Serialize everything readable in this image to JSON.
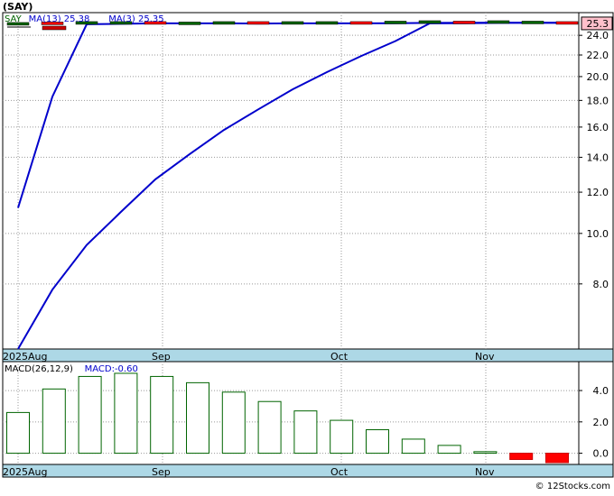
{
  "title": "(SAY)",
  "watermark": "© 12Stocks.com",
  "chart_data": [
    {
      "type": "line",
      "panel": "price",
      "legend": [
        {
          "label": "SAY",
          "color": "#006400"
        },
        {
          "label": "MA(13)",
          "value": "25.38",
          "color": "#0000cc"
        },
        {
          "label": "MA(3)",
          "value": "25.35",
          "color": "#0000cc"
        }
      ],
      "last_price_label": "25.3",
      "y_scale": "log",
      "ylim": [
        6.0,
        24.5
      ],
      "yticks": [
        "8.0",
        "10.0",
        "12.0",
        "14.0",
        "16.0",
        "18.0",
        "20.0",
        "22.0",
        "24.0"
      ],
      "x_months": [
        "2025Aug",
        "Sep",
        "Oct",
        "Nov"
      ],
      "price": [
        25.2,
        25.25,
        25.3,
        25.3,
        25.3,
        25.25,
        25.3,
        25.3,
        25.3,
        25.3,
        25.3,
        25.35,
        25.4,
        25.35,
        25.4,
        25.35,
        25.3
      ],
      "series": [
        {
          "name": "MA(3)",
          "values": [
            11.2,
            18.3,
            25.2,
            25.25,
            25.3,
            25.3,
            25.3,
            25.28,
            25.3,
            25.3,
            25.3,
            25.32,
            25.35,
            25.37,
            25.38,
            25.37,
            25.35
          ]
        },
        {
          "name": "MA(13)",
          "values": [
            6.0,
            7.8,
            9.5,
            11.0,
            12.7,
            14.2,
            15.8,
            17.3,
            18.9,
            20.4,
            21.9,
            23.4,
            25.3,
            25.32,
            25.35,
            25.37,
            25.38
          ]
        }
      ]
    },
    {
      "type": "bar",
      "panel": "macd",
      "legend": [
        {
          "label": "MACD(26,12,9)",
          "color": "#000000"
        },
        {
          "label": "MACD:-0.60",
          "color": "#0000cc"
        }
      ],
      "ylim": [
        -0.6,
        5.5
      ],
      "yticks": [
        "0.0",
        "2.0",
        "4.0"
      ],
      "x_months": [
        "2025Aug",
        "Sep",
        "Oct",
        "Nov"
      ],
      "values": [
        2.6,
        4.1,
        4.9,
        5.1,
        4.9,
        4.5,
        3.9,
        3.3,
        2.7,
        2.1,
        1.5,
        0.9,
        0.5,
        0.1,
        -0.4,
        -0.6
      ]
    }
  ]
}
